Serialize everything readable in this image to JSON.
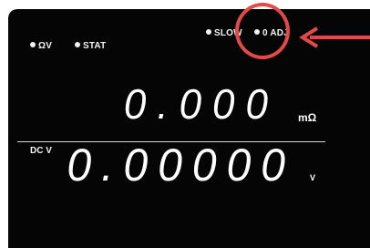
{
  "indicators": {
    "ohm_v": "ΩV",
    "stat": "STAT",
    "slow": "SLOW",
    "zero_adj": "0 ADJ"
  },
  "main_reading": {
    "value": "0.000",
    "unit": "mΩ"
  },
  "sub_reading": {
    "label": "DC V",
    "value": "0.00000",
    "unit": "V"
  },
  "colors": {
    "display_bg": "#050505",
    "segment": "#ffffff",
    "highlight": "#e24a4a"
  },
  "annotations": {
    "highlight_target": "0 ADJ",
    "arrow_icon": "arrow-left-icon"
  }
}
